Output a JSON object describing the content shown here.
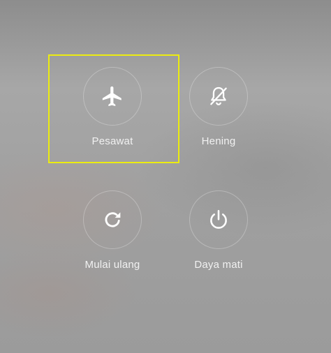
{
  "power_menu": {
    "items": [
      {
        "label": "Pesawat",
        "icon": "airplane-icon"
      },
      {
        "label": "Hening",
        "icon": "bell-off-icon"
      },
      {
        "label": "Mulai ulang",
        "icon": "restart-icon"
      },
      {
        "label": "Daya mati",
        "icon": "power-icon"
      }
    ],
    "highlight_color": "#ecec10"
  }
}
